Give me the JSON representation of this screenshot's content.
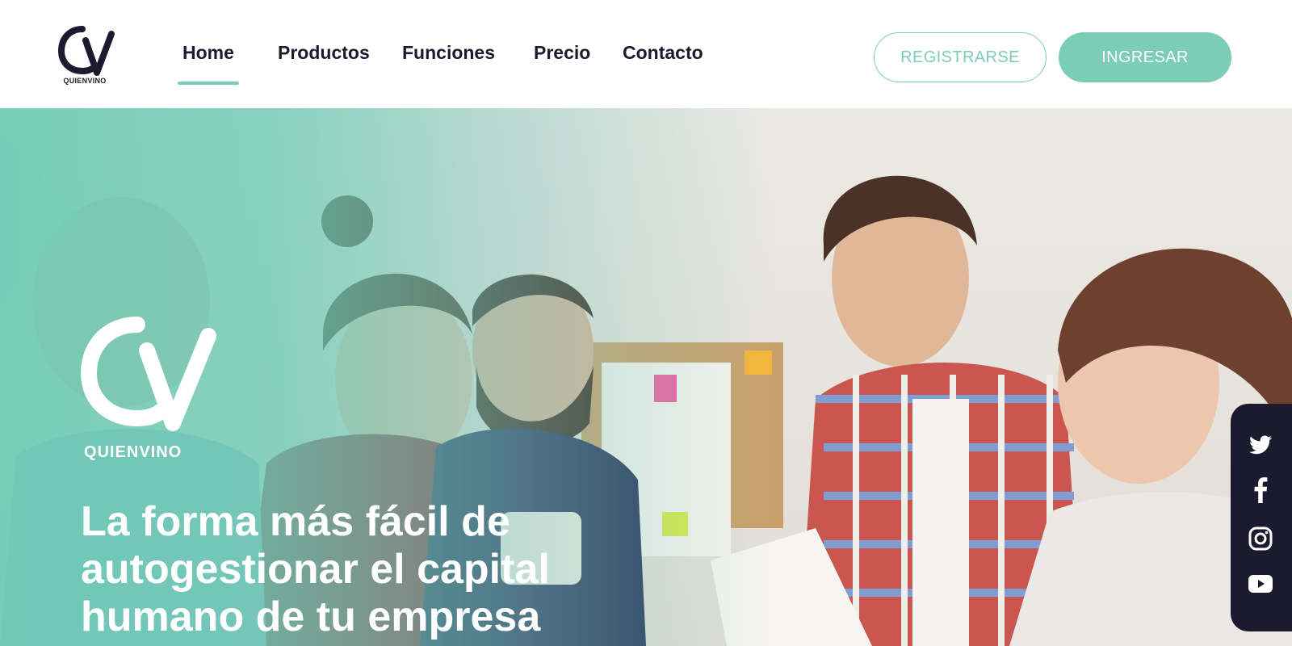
{
  "brand": {
    "name": "QUIENVINO"
  },
  "nav": {
    "items": [
      {
        "label": "Home",
        "active": true
      },
      {
        "label": "Productos"
      },
      {
        "label": "Funciones"
      },
      {
        "label": "Precio"
      },
      {
        "label": "Contacto"
      }
    ]
  },
  "auth": {
    "register_label": "REGISTRARSE",
    "login_label": "INGRESAR"
  },
  "hero": {
    "brand": "QUIENVINO",
    "headline": "La forma más fácil de autogestionar el capital humano de tu empresa"
  },
  "social": {
    "icons": [
      "twitter-icon",
      "facebook-icon",
      "instagram-icon",
      "youtube-icon"
    ]
  },
  "colors": {
    "accent": "#7ccdb8",
    "dark": "#1c1a2e",
    "white": "#ffffff"
  }
}
